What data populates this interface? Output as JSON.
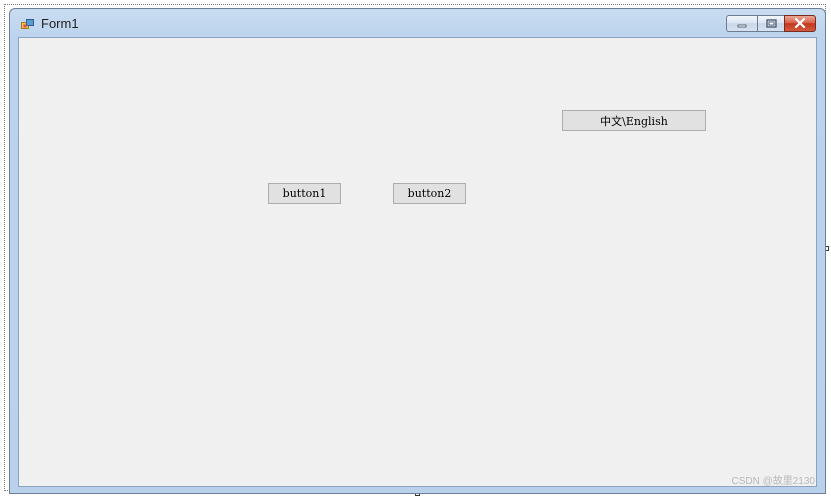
{
  "window": {
    "title": "Form1",
    "icon": "form-icon"
  },
  "caption_buttons": {
    "minimize": "minimize-icon",
    "maximize": "maximize-icon",
    "close": "close-icon"
  },
  "form": {
    "buttons": {
      "language_toggle": "中文\\English",
      "button1": "button1",
      "button2": "button2"
    }
  },
  "watermark": "CSDN @故里2130",
  "colors": {
    "client_background": "#f0f0f0",
    "frame": "#b9d1ea",
    "close_button": "#c2381f",
    "button_face": "#e1e1e1"
  }
}
